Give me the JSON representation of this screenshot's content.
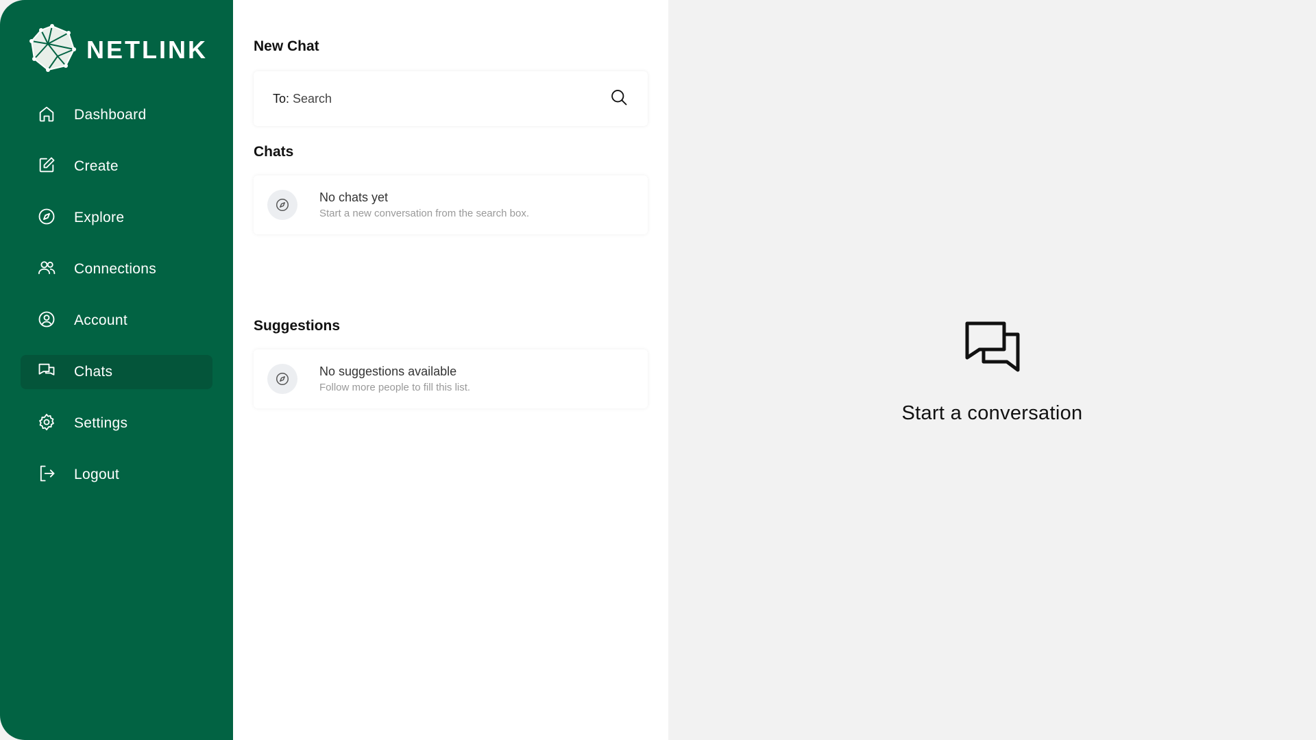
{
  "brand": {
    "name": "NETLINK",
    "color": "#026343"
  },
  "sidebar": {
    "items": [
      {
        "label": "Dashboard",
        "icon": "home-icon"
      },
      {
        "label": "Create",
        "icon": "edit-icon"
      },
      {
        "label": "Explore",
        "icon": "compass-icon"
      },
      {
        "label": "Connections",
        "icon": "users-icon"
      },
      {
        "label": "Account",
        "icon": "user-circle-icon"
      },
      {
        "label": "Chats",
        "icon": "chat-icon",
        "active": true
      },
      {
        "label": "Settings",
        "icon": "gear-icon"
      },
      {
        "label": "Logout",
        "icon": "logout-icon"
      }
    ]
  },
  "new_chat": {
    "title": "New Chat",
    "to_label": "To:",
    "search_placeholder": "Search"
  },
  "chats": {
    "title": "Chats",
    "empty_title": "No chats yet",
    "empty_sub": "Start a new conversation from the search box."
  },
  "suggestions": {
    "title": "Suggestions",
    "empty_title": "No suggestions available",
    "empty_sub": "Follow more people to fill this list."
  },
  "conversation": {
    "title": "Start a conversation"
  }
}
